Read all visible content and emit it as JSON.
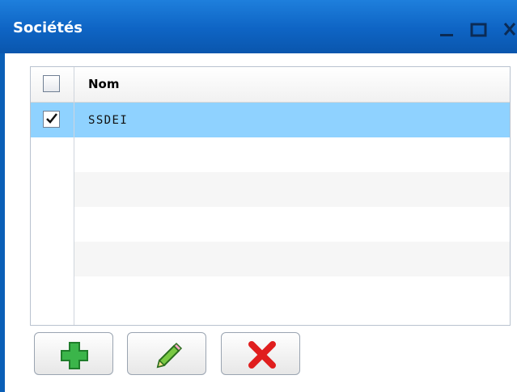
{
  "window": {
    "title": "Sociétés"
  },
  "grid": {
    "columns": [
      "Nom"
    ],
    "rows": [
      {
        "checked": true,
        "nom": "SSDEI"
      }
    ]
  },
  "buttons": {
    "add": "add",
    "edit": "edit",
    "delete": "delete"
  },
  "colors": {
    "title_bar": "#0f66c6",
    "selected_row": "#8fd2ff",
    "add_icon": "#3bb54a",
    "delete_icon": "#e01e1e"
  }
}
